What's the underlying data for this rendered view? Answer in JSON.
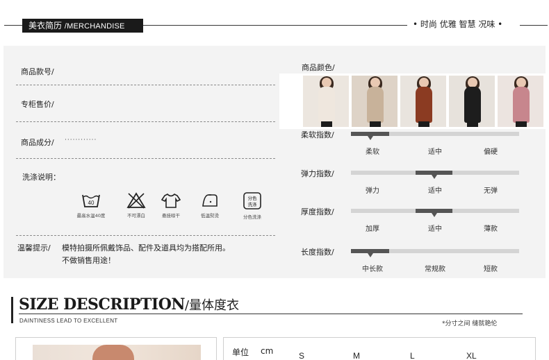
{
  "header": {
    "tag_cn": "美衣简历",
    "tag_en": "/MERCHANDISE",
    "slogan": "• 时尚 优雅 智慧 况味 •"
  },
  "info": {
    "item_no_label": "商品款号/",
    "price_label": "专柜售价/",
    "composition_label": "商品成分/",
    "composition_value": "············",
    "wash_label": "洗涤说明：",
    "notice_label": "温馨提示/",
    "notice_line1": "模特拍摄所佩戴饰品、配件及道具均为搭配所用。",
    "notice_line2": "不做销售用途！"
  },
  "wash_icons": [
    {
      "icon": "wash-40-icon",
      "inner": "40",
      "caption": "最高水温40度"
    },
    {
      "icon": "no-bleach-icon",
      "inner": "",
      "caption": "不可漂白"
    },
    {
      "icon": "hang-dry-icon",
      "inner": "",
      "caption": "悬挂晾干"
    },
    {
      "icon": "low-iron-icon",
      "inner": "",
      "caption": "低温熨烫"
    },
    {
      "icon": "wash-separately-icon",
      "inner": "分色洗涤",
      "caption": "分色洗涤"
    }
  ],
  "colors": {
    "label": "商品颜色/",
    "swatches": [
      {
        "name": "white",
        "body": "#efe7de",
        "bg": "#ece6df"
      },
      {
        "name": "khaki",
        "body": "#c8b29a",
        "bg": "#ded3c7"
      },
      {
        "name": "rust",
        "body": "#8b3b22",
        "bg": "#e9e4de"
      },
      {
        "name": "black",
        "body": "#1d1d1d",
        "bg": "#e7e2dc"
      },
      {
        "name": "pink",
        "body": "#c7868d",
        "bg": "#ece4e0"
      }
    ]
  },
  "indices": [
    {
      "label": "柔软指数/",
      "options": [
        "柔软",
        "适中",
        "偏硬"
      ],
      "level": 0
    },
    {
      "label": "弹力指数/",
      "options": [
        "弹力",
        "适中",
        "无弹"
      ],
      "level": 1
    },
    {
      "label": "厚度指数/",
      "options": [
        "加厚",
        "适中",
        "薄款"
      ],
      "level": 1
    },
    {
      "label": "长度指数/",
      "options": [
        "中长款",
        "常规款",
        "短款"
      ],
      "level": 0
    }
  ],
  "size": {
    "title_en": "SIZE DESCRIPTION",
    "title_cn": "/量体度衣",
    "subtitle": "DAINTINESS LEAD TO EXCELLENT",
    "note": "*分寸之间 缝就艳伦",
    "unit_label": "单位",
    "unit_value": "cm",
    "sizes": [
      "S",
      "M",
      "L",
      "XL"
    ]
  },
  "accent": {
    "dark": "#1a1a1a",
    "bar_track": "#d4d4d4",
    "bar_fill": "#555555",
    "panel": "#f3f3f3"
  }
}
